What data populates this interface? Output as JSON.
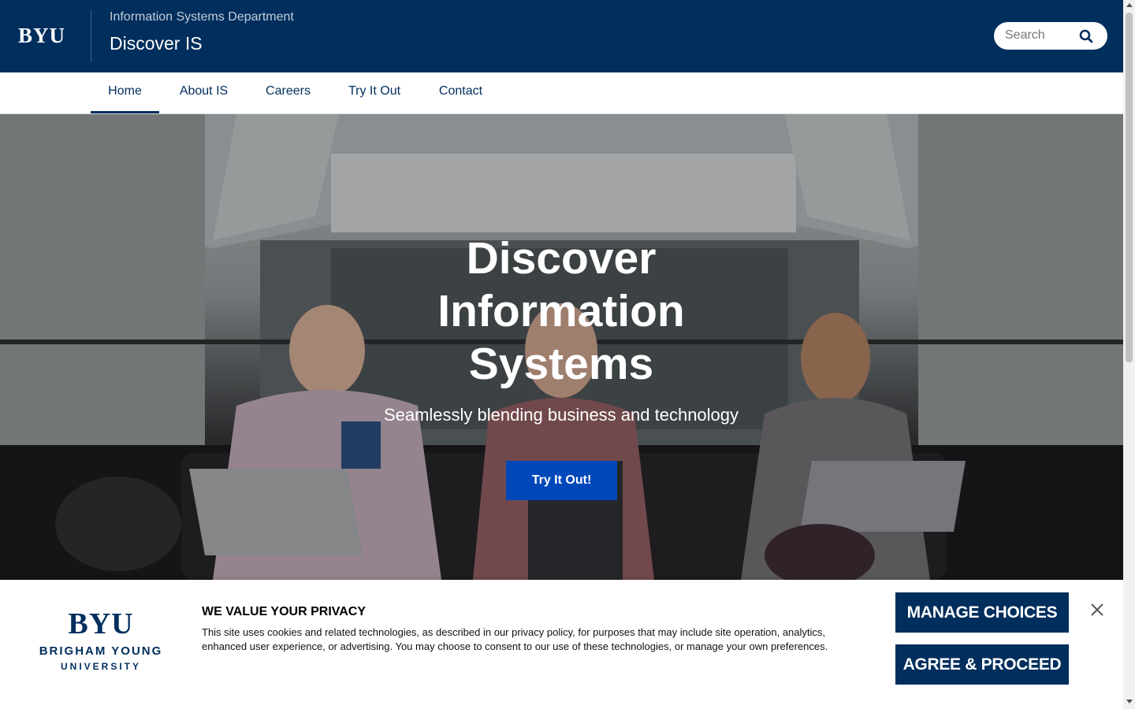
{
  "header": {
    "logo": "BYU",
    "department": "Information Systems Department",
    "site_title": "Discover IS",
    "search_placeholder": "Search",
    "search_icon": "search-icon"
  },
  "nav": {
    "items": [
      {
        "label": "Home",
        "active": true
      },
      {
        "label": "About IS",
        "active": false
      },
      {
        "label": "Careers",
        "active": false
      },
      {
        "label": "Try It Out",
        "active": false
      },
      {
        "label": "Contact",
        "active": false
      }
    ]
  },
  "hero": {
    "title_line1": "Discover",
    "title_line2": "Information",
    "title_line3": "Systems",
    "subtitle": "Seamlessly blending business and technology",
    "button_label": "Try It Out!"
  },
  "privacy": {
    "logo_mark": "BYU",
    "logo_line1": "BRIGHAM YOUNG",
    "logo_line2": "UNIVERSITY",
    "heading": "WE VALUE YOUR PRIVACY",
    "text": "This site uses cookies and related technologies, as described in our privacy policy, for purposes that may include site operation, analytics, enhanced user experience, or advertising. You may choose to consent to our use of these technologies, or manage your own preferences.",
    "manage_label": "MANAGE CHOICES",
    "agree_label": "AGREE & PROCEED",
    "close_icon": "close-icon"
  },
  "colors": {
    "brand_navy": "#002e5d",
    "button_blue": "#0047ba"
  }
}
